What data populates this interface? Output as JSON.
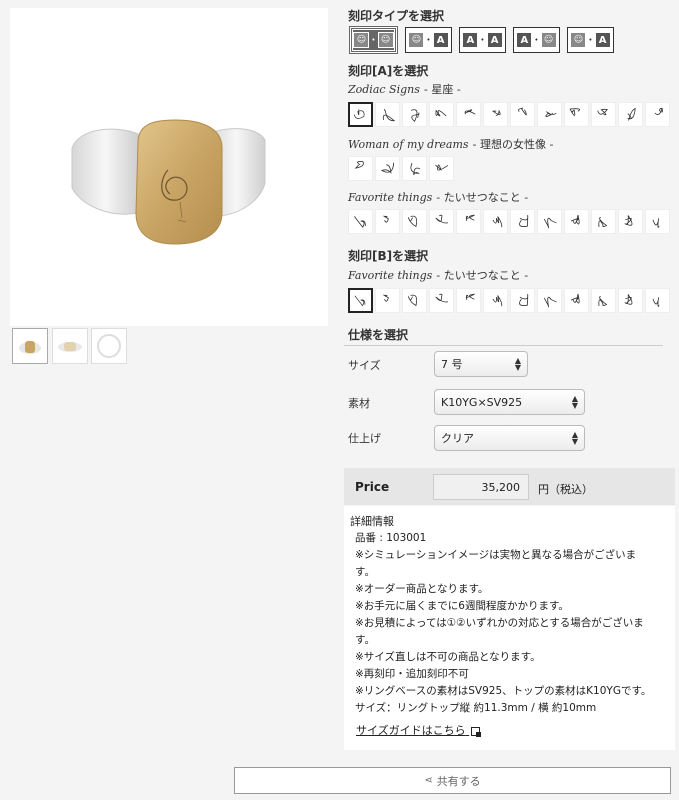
{
  "gallery": {
    "main_image_icon": "ring-photo",
    "thumbnails": [
      "ring-front-thumb",
      "ring-side-thumb",
      "ring-band-thumb"
    ]
  },
  "engraving_type": {
    "title": "刻印タイプを選択",
    "options": [
      {
        "left": "face",
        "right": "face"
      },
      {
        "left": "face",
        "right": "A"
      },
      {
        "left": "A",
        "right": "A"
      },
      {
        "left": "A",
        "right": "face"
      },
      {
        "left": "face",
        "right": "A"
      }
    ],
    "selected_index": 0
  },
  "engraving_a": {
    "title": "刻印[A]を選択",
    "categories": [
      {
        "script": "Zodiac Signs",
        "label": "- 星座 -",
        "count": 12,
        "selected_index": 0
      },
      {
        "script": "Woman of my dreams",
        "label": "- 理想の女性像 -",
        "count": 4,
        "selected_index": -1
      },
      {
        "script": "Favorite things",
        "label": "- たいせつなこと -",
        "count": 12,
        "selected_index": -1
      }
    ]
  },
  "engraving_b": {
    "title": "刻印[B]を選択",
    "category": {
      "script": "Favorite things",
      "label": "- たいせつなこと -",
      "count": 12,
      "selected_index": 0
    }
  },
  "spec": {
    "title": "仕様を選択",
    "rows": [
      {
        "label": "サイズ",
        "value": "7 号"
      },
      {
        "label": "素材",
        "value": "K10YG×SV925"
      },
      {
        "label": "仕上げ",
        "value": "クリア"
      }
    ]
  },
  "price": {
    "label": "Price",
    "value": "35,200",
    "suffix": "円（税込）"
  },
  "details": {
    "title": "詳細情報",
    "lines": [
      "品番 : 103001",
      "※シミュレーションイメージは実物と異なる場合がございま",
      "す。",
      "※オーダー商品となります。",
      "※お手元に届くまでに6週間程度かかります。",
      "※お見積によっては①②いずれかの対応とする場合がございま",
      "す。",
      "※サイズ直しは不可の商品となります。",
      "※再刻印・追加刻印不可",
      "※リングベースの素材はSV925、トップの素材はK10YGです。",
      "サイズ：リングトップ縦 約11.3mm / 横 約10mm"
    ],
    "size_guide_link": "サイズガイドはこちら"
  },
  "share": {
    "label": "共有する",
    "icon": "share-icon"
  },
  "colors": {
    "gold": "#c9a565",
    "silver": "#e8e8e8",
    "selected_type_bg": "#666666"
  }
}
